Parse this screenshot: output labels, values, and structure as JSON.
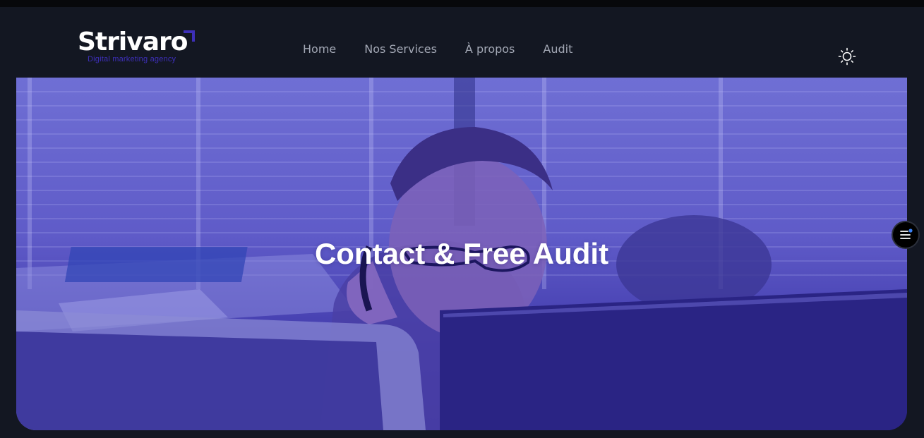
{
  "brand": {
    "name": "Strivaro",
    "tagline": "Digital marketing agency",
    "accent_color": "#3d2fb8"
  },
  "nav": {
    "items": [
      {
        "label": "Home"
      },
      {
        "label": "Nos Services"
      },
      {
        "label": "À propos"
      },
      {
        "label": "Audit"
      }
    ]
  },
  "header": {
    "theme_toggle_icon": "sun-icon"
  },
  "hero": {
    "title": "Contact & Free Audit",
    "overlay_color": "#5b57c9"
  },
  "floating": {
    "menu_icon": "menu-lines-icon",
    "badge_color": "#3b82f6"
  }
}
